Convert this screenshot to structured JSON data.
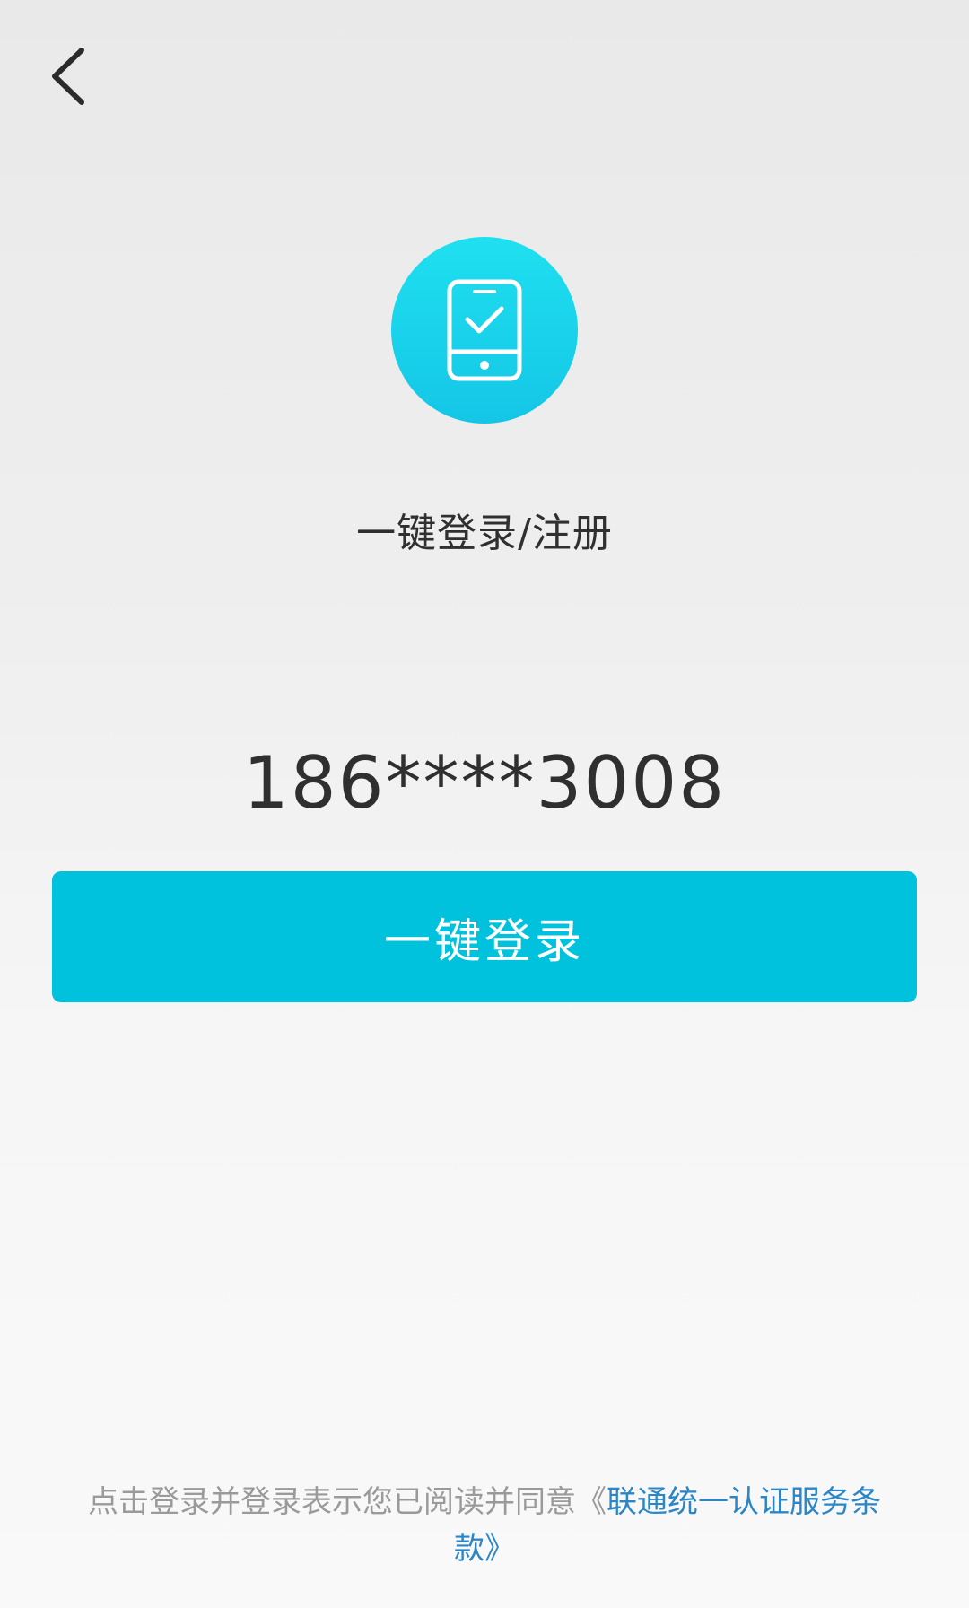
{
  "header": {
    "back_icon": "chevron-left-icon"
  },
  "logo": {
    "icon": "phone-check-icon",
    "bg_color": "#16d0ea"
  },
  "title": "一键登录/注册",
  "phone_number": "186****3008",
  "login_button": {
    "label": "一键登录",
    "bg_color": "#00c2dd"
  },
  "agreement": {
    "prefix": "点击登录并登录表示您已阅读并同意",
    "open_quote": "《",
    "link_text": "联通统一认证服务条款",
    "close_quote": "》",
    "link_color": "#2b86c8"
  }
}
